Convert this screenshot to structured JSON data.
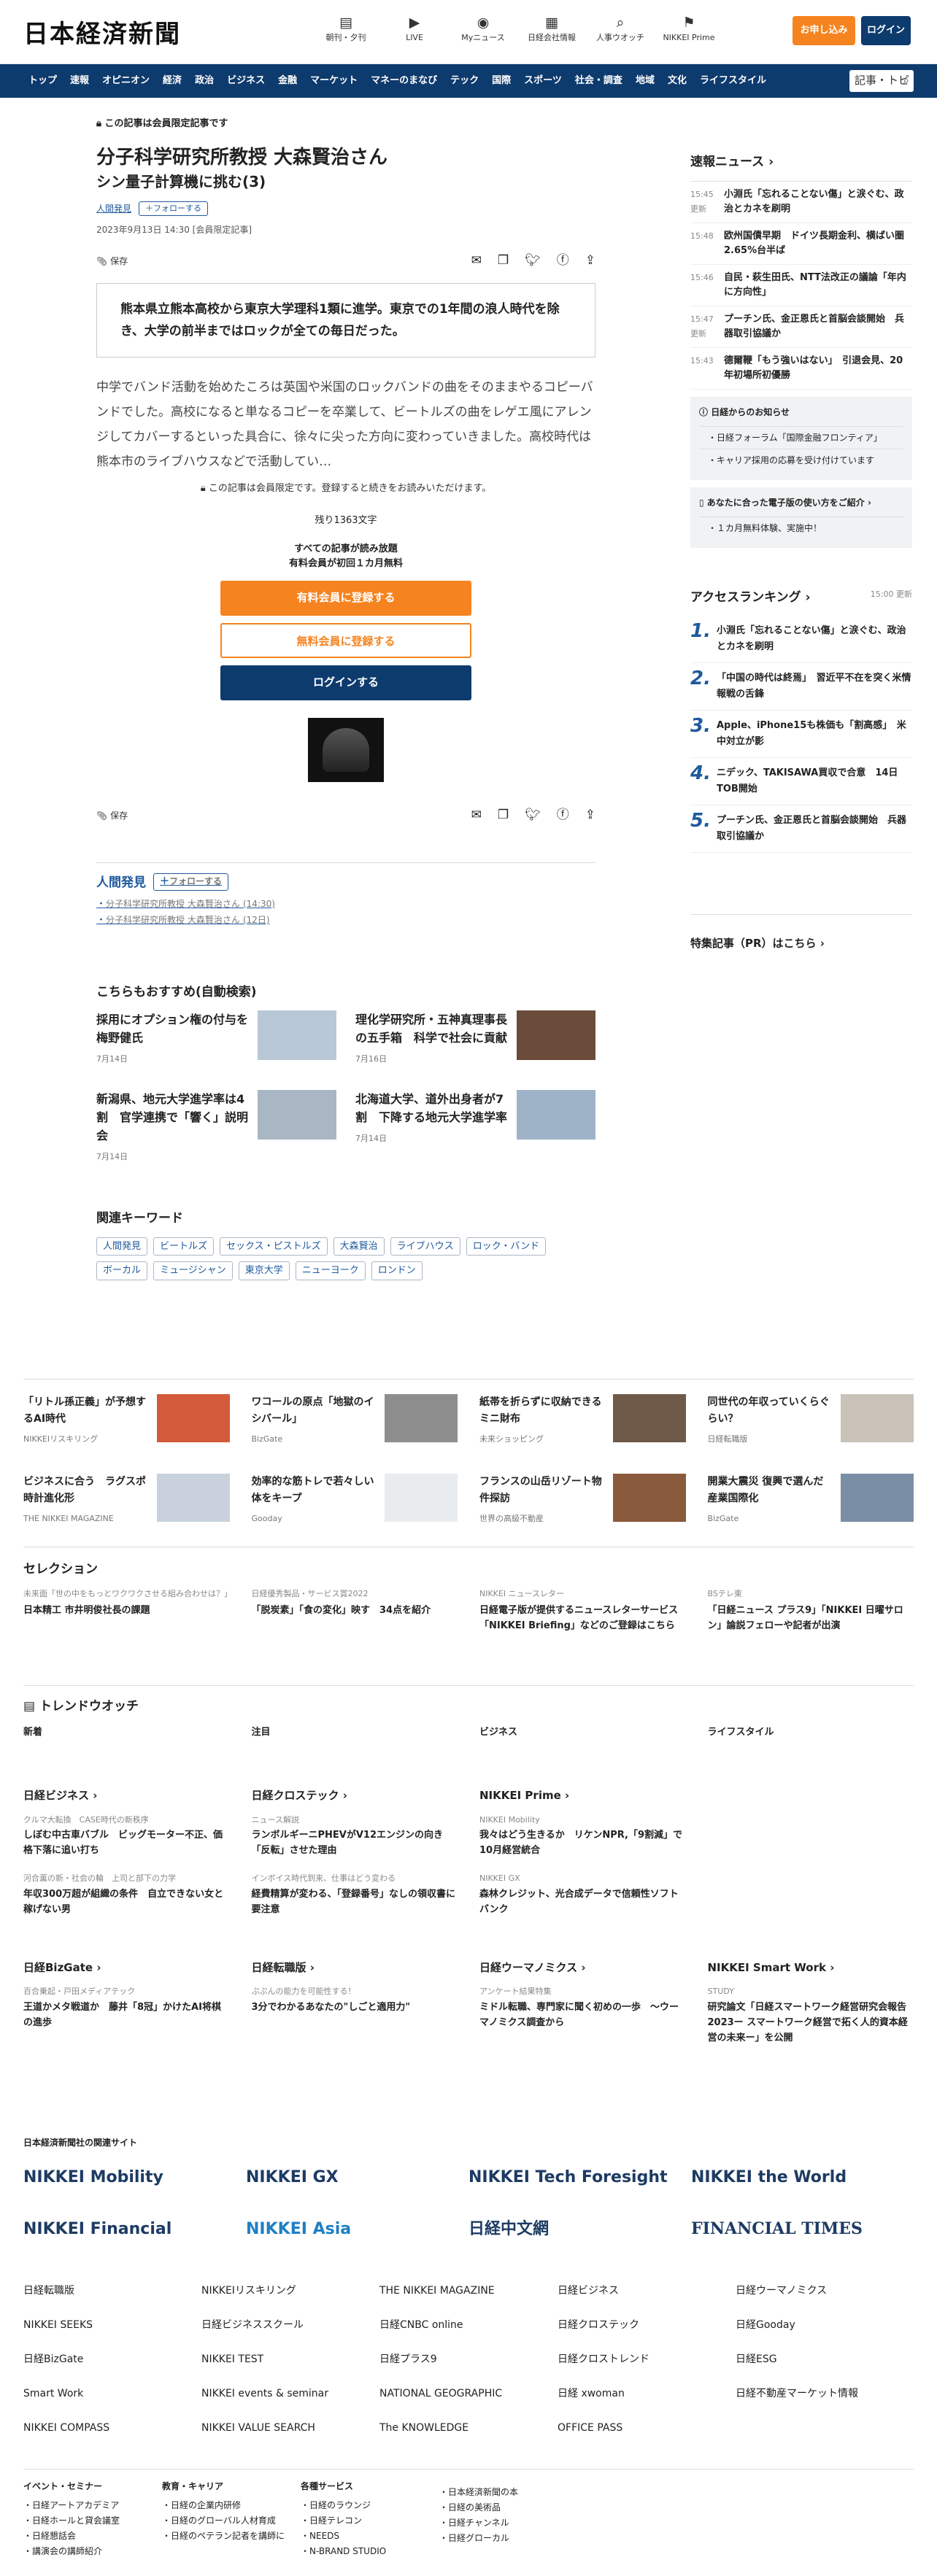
{
  "header": {
    "logo": "日本経済新聞",
    "icons": [
      {
        "icon": "newspaper-icon",
        "label": "朝刊・夕刊"
      },
      {
        "icon": "video-icon",
        "label": "LIVE"
      },
      {
        "icon": "user-icon",
        "label": "Myニュース"
      },
      {
        "icon": "building-icon",
        "label": "日経会社情報"
      },
      {
        "icon": "search-icon",
        "label": "人事ウオッチ"
      },
      {
        "icon": "flag-icon",
        "label": "NIKKEI Prime"
      }
    ],
    "subscribe": "お申し込み",
    "login": "ログイン"
  },
  "nav": {
    "items": [
      "トップ",
      "速報",
      "オピニオン",
      "経済",
      "政治",
      "ビジネス",
      "金融",
      "マーケット",
      "マネーのまなび",
      "テック",
      "国際",
      "スポーツ",
      "社会・調査",
      "地域",
      "文化",
      "ライフスタイル"
    ],
    "search_placeholder": "記事・トピ"
  },
  "article": {
    "members_only": "この記事は会員限定記事です",
    "title": "分子科学研究所教授 大森賢治さん",
    "subtitle": "シン量子計算機に挑む(3)",
    "series_tag": "人間発見",
    "follow": "フォローする",
    "date": "2023年9月13日 14:30 [会員限定記事]",
    "save": "保存",
    "lead": "熊本県立熊本高校から東京大学理科1類に進学。東京での1年間の浪人時代を除き、大学の前半まではロックが全ての毎日だった。",
    "body": "中学でバンド活動を始めたころは英国や米国のロックバンドの曲をそのままやるコピーバンドでした。高校になると単なるコピーを卒業して、ビートルズの曲をレゲエ風にアレンジしてカバーするといった具合に、徐々に尖った方向に変わっていきました。高校時代は熊本市のライブハウスなどで活動してい…"
  },
  "paywall": {
    "note": "この記事は会員限定です。登録すると続きをお読みいただけます。",
    "remaining": "残り1363文字",
    "t1": "すべての記事が読み放題",
    "t2": "有料会員が初回１カ月無料",
    "paid": "有料会員に登録する",
    "free": "無料会員に登録する",
    "login": "ログインする"
  },
  "related": {
    "title": "人間発見",
    "follow": "フォローする",
    "links": [
      {
        "text": "分子科学研究所教授 大森賢治さん",
        "time": "(14:30)"
      },
      {
        "text": "分子科学研究所教授 大森賢治さん",
        "time": "(12日)"
      }
    ]
  },
  "recommend": {
    "title": "こちらもおすすめ(自動検索)",
    "items": [
      {
        "title": "採用にオプション権の付与を　梅野健氏",
        "date": "7月14日"
      },
      {
        "title": "理化学研究所・五神真理事長の五手箱　科学で社会に貢献",
        "date": "7月16日"
      },
      {
        "title": "新潟県、地元大学進学率は4割　官学連携で「響く」説明会",
        "date": "7月14日"
      },
      {
        "title": "北海道大学、道外出身者が7割　下降する地元大学進学率",
        "date": "7月14日"
      }
    ]
  },
  "keywords": {
    "title": "関連キーワード",
    "items": [
      "人間発見",
      "ビートルズ",
      "セックス・ピストルズ",
      "大森賢治",
      "ライブハウス",
      "ロック・バンド",
      "ボーカル",
      "ミュージシャン",
      "東京大学",
      "ニューヨーク",
      "ロンドン"
    ]
  },
  "sidebar": {
    "news_title": "速報ニュース",
    "news": [
      {
        "time": "15:45",
        "tag": "更新",
        "title": "小淵氏「忘れることない傷」と涙ぐむ、政治とカネを刷明"
      },
      {
        "time": "15:48",
        "tag": "",
        "title": "欧州国債早期　ドイツ長期金利、横ばい圏2.65%台半ば"
      },
      {
        "time": "15:46",
        "tag": "",
        "title": "自民・萩生田氏、NTT法改正の議論「年内に方向性」"
      },
      {
        "time": "15:47",
        "tag": "更新",
        "title": "プーチン氏、金正恩氏と首脳会談開始　兵器取引協議か"
      },
      {
        "time": "15:43",
        "tag": "",
        "title": "德爾鞭「もう強いはない」　引退会見、20年初場所初優勝"
      }
    ],
    "notice_title": "日経からのお知らせ",
    "notices": [
      "日経フォーラム「国際金融フロンティア」",
      "キャリア採用の応募を受け付けています"
    ],
    "epaper_title": "あなたに合った電子版の使い方をご紹介",
    "epaper_items": [
      "１カ月無料体験、実施中！"
    ],
    "rank_title": "アクセスランキング",
    "rank_time": "15:00 更新",
    "ranks": [
      "小淵氏「忘れることない傷」と涙ぐむ、政治とカネを刷明",
      "「中国の時代は終焉」　習近平不在を突く米情報戦の舌鋒",
      "Apple、iPhone15も株価も「割高感」　米中対立が影",
      "ニデック、TAKISAWA買収で合意　14日TOB開始",
      "プーチン氏、金正恩氏と首脳会談開始　兵器取引協議か"
    ],
    "pr_title": "特集記事（PR）はこちら"
  },
  "pr": [
    {
      "title": "「リトル孫正義」が予想するAI時代",
      "src": "NIKKEIリスキリング"
    },
    {
      "title": "ワコールの原点「地獄のイシバール」",
      "src": "BizGate"
    },
    {
      "title": "紙帯を折らずに収納できるミニ財布",
      "src": "未来ショッピング"
    },
    {
      "title": "同世代の年収っていくらぐらい？",
      "src": "日経転職版"
    },
    {
      "title": "ビジネスに合う　ラグスポ時計進化形",
      "src": "THE NIKKEI MAGAZINE"
    },
    {
      "title": "効率的な筋トレで若々しい体をキープ",
      "src": "Gooday"
    },
    {
      "title": "フランスの山岳リゾート物件探訪",
      "src": "世界の高級不動産"
    },
    {
      "title": "開業大震災 復興で選んだ産業国際化",
      "src": "BizGate"
    }
  ],
  "selection": {
    "title": "セレクション",
    "items": [
      {
        "k": "未来面「世の中をもっとワクワクさせる組み合わせは？」",
        "t": "日本精工 市井明俊社長の課題"
      },
      {
        "k": "日経優秀製品・サービス賞2022",
        "t": "「脱炭素」「食の変化」映す　34点を紹介"
      },
      {
        "k": "NIKKEI ニュースレター",
        "t": "日経電子版が提供するニュースレターサービス「NIKKEI Briefing」などのご登録はこちら"
      },
      {
        "k": "BSテレ東",
        "t": "「日経ニュース プラス9」「NIKKEI 日曜サロン」論説フェローや記者が出演"
      }
    ]
  },
  "trend": {
    "title": "トレンドウオッチ",
    "cols": [
      "新着",
      "注目",
      "ビジネス",
      "ライフスタイル"
    ]
  },
  "services": [
    {
      "name": "日経ビジネス",
      "items": [
        {
          "k": "クルマ大転換　CASE時代の新秩序",
          "t": "しぼむ中古車バブル　ビッグモーター不正、価格下落に追い打ち"
        },
        {
          "k": "河合薫の新・社会の輪　上司と部下の力学",
          "t": "年収300万超が組織の条件　自立できない女と稼げない男"
        }
      ]
    },
    {
      "name": "日経クロステック",
      "items": [
        {
          "k": "ニュース解説",
          "t": "ランボルギーニPHEVがV12エンジンの向き「反転」させた理由"
        },
        {
          "k": "インボイス時代到来、仕事はどう変わる",
          "t": "経費精算が変わる、「登録番号」なしの領収書に要注意"
        }
      ]
    },
    {
      "name": "NIKKEI Prime",
      "items": [
        {
          "k": "NIKKEI Mobility",
          "t": "我々はどう生きるか　リケンNPR,「9割減」で10月経営統合"
        },
        {
          "k": "NIKKEI GX",
          "t": "森林クレジット、光合成データで信頼性ソフトバンク"
        }
      ]
    },
    {
      "name": "",
      "items": []
    },
    {
      "name": "日経BizGate",
      "items": [
        {
          "k": "百合乗起・戸田メディアテック",
          "t": "王道かメタ戦道か　藤井「8冠」かけたAI将棋の進歩"
        }
      ]
    },
    {
      "name": "日経転職版",
      "items": [
        {
          "k": "ぷぷんの能力を可能性する！",
          "t": "3分でわかるあなたの\"しごと適用力\""
        }
      ]
    },
    {
      "name": "日経ウーマノミクス",
      "items": [
        {
          "k": "アンケート結果特集",
          "t": "ミドル転職、専門家に聞く初めの一歩　〜ウーマノミクス調査から"
        }
      ]
    },
    {
      "name": "NIKKEI Smart Work",
      "items": [
        {
          "k": "STUDY",
          "t": "研究論文「日経スマートワーク経営研究会報告2023ー スマートワーク経営で拓く人的資本経営の未来ー」を公開"
        }
      ]
    }
  ],
  "group": {
    "title": "日本経済新聞社の関連サイト",
    "big": [
      "NIKKEI Mobility",
      "NIKKEI GX",
      "NIKKEI Tech Foresight",
      "NIKKEI the World",
      "NIKKEI Financial",
      "NIKKEI Asia",
      "日経中文網",
      "FINANCIAL TIMES"
    ],
    "small": [
      "日経転職版",
      "NIKKEIリスキリング",
      "THE NIKKEI MAGAZINE",
      "日経ビジネス",
      "日経ウーマノミクス",
      "NIKKEI SEEKS",
      "日経ビジネススクール",
      "日経CNBC online",
      "日経クロステック",
      "日経Gooday",
      "日経BizGate",
      "NIKKEI TEST",
      "日経プラス9",
      "日経クロストレンド",
      "日経ESG",
      "Smart Work",
      "NIKKEI events & seminar",
      "NATIONAL GEOGRAPHIC",
      "日経 xwoman",
      "日経不動産マーケット情報",
      "NIKKEI COMPASS",
      "NIKKEI VALUE SEARCH",
      "The KNOWLEDGE",
      "OFFICE PASS",
      ""
    ]
  },
  "footer": [
    {
      "h": "イベント・セミナー",
      "items": [
        "日経アートアカデミア",
        "日経ホールと貸会議室",
        "日経懇話会",
        "講演会の講師紹介"
      ]
    },
    {
      "h": "教育・キャリア",
      "items": [
        "日経の企業内研修",
        "日経のグローバル人材育成",
        "日経のペテラン記者を講師に"
      ]
    },
    {
      "h": "各種サービス",
      "items": [
        "日経のラウンジ",
        "日経テレコン",
        "NEEDS",
        "N-BRAND STUDIO"
      ]
    },
    {
      "h": "",
      "items": [
        "日本経済新聞の本",
        "日経の美術品",
        "日経チャンネル",
        "日経グローカル"
      ]
    }
  ]
}
